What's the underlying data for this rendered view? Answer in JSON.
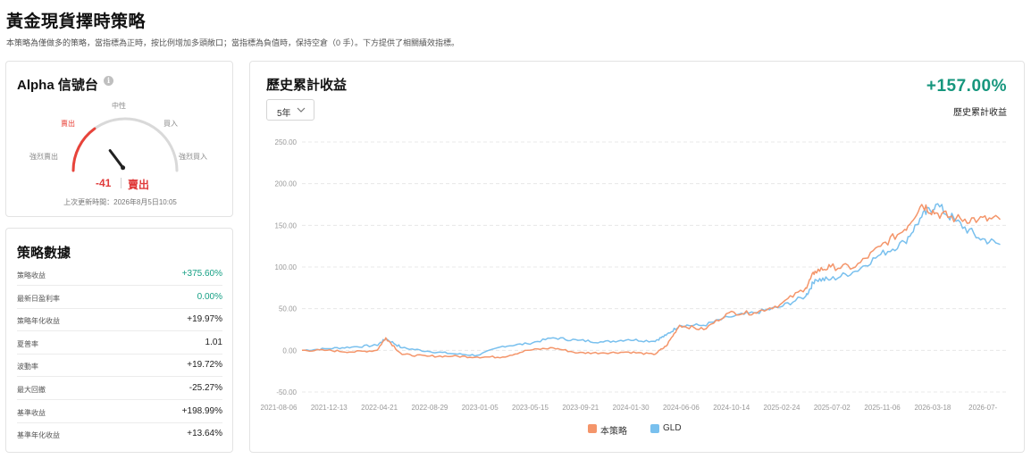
{
  "page": {
    "title": "黃金現貨擇時策略",
    "description": "本策略為僅做多的策略，當指標為正時，按比例增加多頭敞口；當指標為負值時，保持空倉（0 手）。下方提供了相關績效指標。"
  },
  "alpha": {
    "title": "Alpha 信號台",
    "info_icon": "info-icon",
    "gauge_labels": {
      "strong_sell": "強烈賣出",
      "sell": "賣出",
      "neutral": "中性",
      "buy": "買入",
      "strong_buy": "強烈買入"
    },
    "value": "-41",
    "value_number": -41,
    "signal": "賣出",
    "updated": "上次更新時間：2026年8月5日10:05",
    "colors": {
      "sell": "#e8433a",
      "track": "#d9d9d9"
    }
  },
  "stats": {
    "title": "策略數據",
    "rows": [
      {
        "label": "策略收益",
        "value": "+375.60%",
        "positive": true
      },
      {
        "label": "最新日盈利率",
        "value": "0.00%",
        "positive": true
      },
      {
        "label": "策略年化收益",
        "value": "+19.97%",
        "positive": false
      },
      {
        "label": "夏普率",
        "value": "1.01",
        "positive": false
      },
      {
        "label": "波動率",
        "value": "+19.72%",
        "positive": false
      },
      {
        "label": "最大回撤",
        "value": "-25.27%",
        "positive": false
      },
      {
        "label": "基準收益",
        "value": "+198.99%",
        "positive": false
      },
      {
        "label": "基準年化收益",
        "value": "+13.64%",
        "positive": false
      }
    ]
  },
  "chart_panel": {
    "title": "歷史累計收益",
    "period": "5年",
    "return_value": "+157.00%",
    "return_label": "歷史累計收益"
  },
  "chart_data": {
    "type": "line",
    "title": "歷史累計收益",
    "xlabel": "",
    "ylabel": "",
    "ylim": [
      -50,
      250
    ],
    "y_ticks": [
      "250.00",
      "200.00",
      "150.00",
      "100.00",
      "50.00",
      "0.00",
      "-50.00"
    ],
    "x_ticks": [
      "2021-08-06",
      "2021-12-13",
      "2022-04-21",
      "2022-08-29",
      "2023-01-05",
      "2023-05-15",
      "2023-09-21",
      "2024-01-30",
      "2024-06-06",
      "2024-10-14",
      "2025-02-24",
      "2025-07-02",
      "2025-11-06",
      "2026-03-18",
      "2026-07-"
    ],
    "grid": "horizontal dashed",
    "legend_position": "bottom-center",
    "series": [
      {
        "name": "本策略",
        "color": "#f4956a",
        "x": [
          "2021-08-06",
          "2021-10-10",
          "2021-12-13",
          "2022-02-15",
          "2022-03-10",
          "2022-04-21",
          "2022-06-25",
          "2022-08-29",
          "2022-11-01",
          "2023-01-05",
          "2023-03-10",
          "2023-05-15",
          "2023-07-18",
          "2023-09-21",
          "2023-11-25",
          "2024-01-30",
          "2024-03-01",
          "2024-04-05",
          "2024-06-06",
          "2024-08-10",
          "2024-10-14",
          "2024-12-20",
          "2025-02-24",
          "2025-03-20",
          "2025-04-29",
          "2025-07-02",
          "2025-09-05",
          "2025-11-06",
          "2025-12-20",
          "2026-01-25",
          "2026-03-18",
          "2026-05-15",
          "2026-07-10"
        ],
        "values": [
          0,
          0,
          -2,
          0,
          15,
          -5,
          -7,
          -7,
          -8,
          -8,
          0,
          3,
          -3,
          -3,
          -2,
          -5,
          5,
          30,
          25,
          45,
          45,
          55,
          75,
          95,
          100,
          100,
          125,
          145,
          175,
          165,
          158,
          157,
          157
        ]
      },
      {
        "name": "GLD",
        "color": "#79c0ee",
        "x": [
          "2021-08-06",
          "2021-10-10",
          "2021-12-13",
          "2022-02-15",
          "2022-03-10",
          "2022-04-21",
          "2022-06-25",
          "2022-08-29",
          "2022-11-01",
          "2023-01-05",
          "2023-03-10",
          "2023-05-15",
          "2023-07-18",
          "2023-09-21",
          "2023-11-25",
          "2024-01-30",
          "2024-03-01",
          "2024-04-05",
          "2024-06-06",
          "2024-08-10",
          "2024-10-14",
          "2024-12-20",
          "2025-02-24",
          "2025-03-20",
          "2025-04-29",
          "2025-07-02",
          "2025-09-05",
          "2025-11-06",
          "2025-12-20",
          "2026-01-25",
          "2026-03-18",
          "2026-05-15",
          "2026-07-10"
        ],
        "values": [
          0,
          2,
          4,
          6,
          14,
          3,
          -1,
          -4,
          -6,
          5,
          8,
          15,
          12,
          10,
          13,
          11,
          18,
          30,
          30,
          40,
          45,
          52,
          65,
          85,
          85,
          95,
          115,
          130,
          160,
          175,
          155,
          135,
          127
        ]
      }
    ]
  }
}
